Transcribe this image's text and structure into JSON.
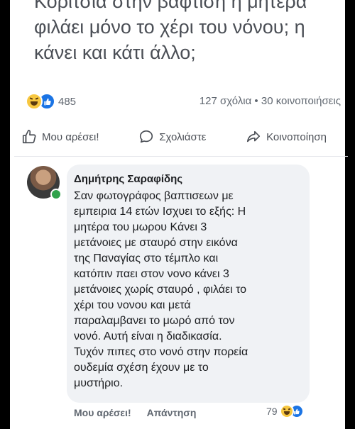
{
  "post": {
    "lines": [
      "Κοριτσια στην βαφτιση η μητερα",
      "φιλάει μόνο το χέρι του νόνου; η",
      "κάνει και κάτι άλλο;"
    ],
    "reaction_count": "485",
    "comments_shares": "127 σχόλια • 30 κοινοποιήσεις"
  },
  "actions": {
    "like": "Μου αρέσει!",
    "comment": "Σχολιάστε",
    "share": "Κοινοποίηση"
  },
  "comment": {
    "author": "Δημήτρης Σαραφίδης",
    "lines": [
      "Σαν φωτογράφος βαπτισεων με",
      "εμπειρια 14 ετών Ισχυει το εξής:  Η",
      "μητέρα του μωρου Κάνει 3",
      "μετάνοιες με σταυρό στην εικόνα",
      "της Παναγίας στο τέμπλο και",
      "κατόπιν παει στον νονο κάνει 3",
      "μετάνοιες χωρίς σταυρό , φιλάει το",
      "χέρι του νονου και μετά",
      "παραλαμβανει το μωρό από τον",
      "νονό.    Αυτή είναι η διαδικασία.",
      "Τυχόν πιπες  στο νονό  στην πορεία",
      "ουδεμία σχέση έχουν με το",
      "μυστήριο."
    ],
    "like_label": "Μου αρέσει!",
    "reply_label": "Απάντηση",
    "reaction_count": "79"
  },
  "colors": {
    "like_blue": "#1b74e4",
    "haha_yellow": "#f7c740",
    "online_green": "#31a24c"
  },
  "icons": [
    "haha-reaction-icon",
    "like-reaction-icon",
    "thumbs-up-icon",
    "comment-bubble-icon",
    "share-arrow-icon"
  ]
}
